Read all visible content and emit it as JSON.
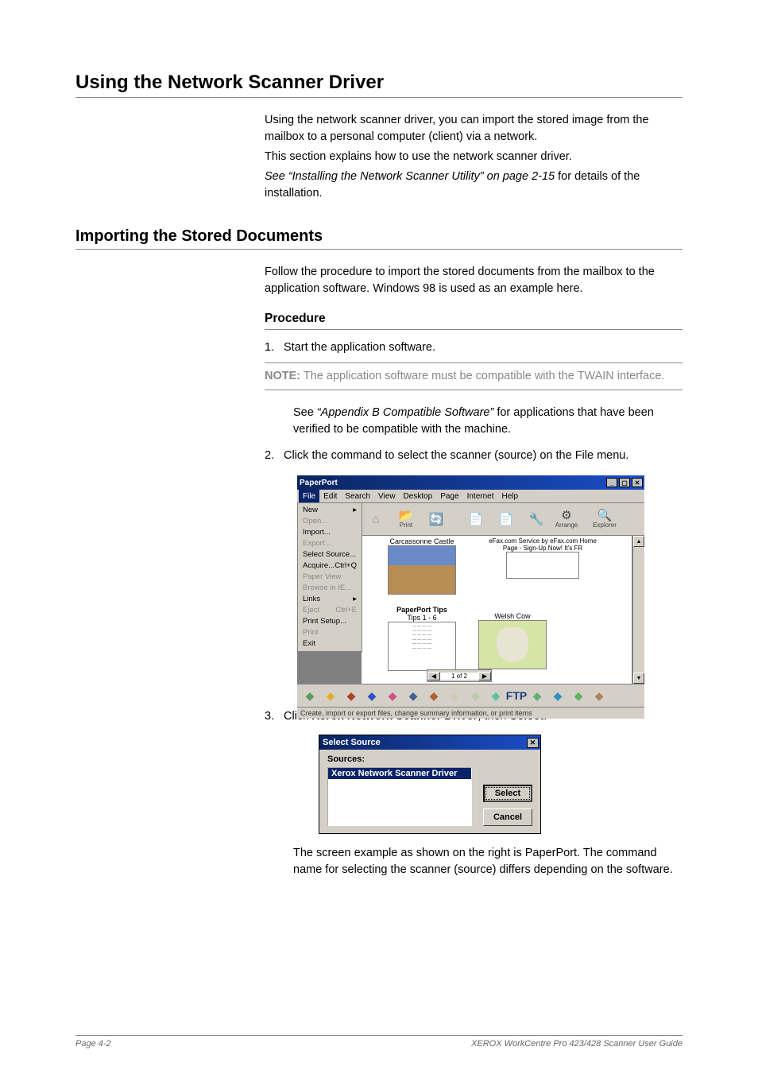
{
  "page": {
    "title": "Using the Network Scanner Driver",
    "intro": {
      "p1": "Using the network scanner driver, you can import the stored image from the mailbox to a personal computer (client) via a network.",
      "p2": "This section explains how to use the network scanner driver.",
      "p3_italic": "See “Installing the Network Scanner Utility” on page 2-15",
      "p3_rest": " for details of the installation."
    },
    "importing_heading": "Importing the Stored Documents",
    "importing_intro": "Follow the procedure to import the stored documents from the mailbox to the application software. Windows 98 is used as an example here.",
    "procedure_heading": "Procedure",
    "step1": {
      "num": "1.",
      "text": "Start the application software."
    },
    "note": {
      "label": "NOTE:",
      "text": " The application software must be compatible with the TWAIN interface."
    },
    "see_text": {
      "pre": "See ",
      "ital": "“Appendix B Compatible Software”",
      "post": " for applications that have been verified to be compatible with the machine."
    },
    "step2": {
      "num": "2.",
      "text": "Click the command to select the scanner (source) on the File menu."
    },
    "step3": {
      "num": "3.",
      "pre": "Click ",
      "b1": "Xerox Network Scanner Driver",
      "mid": ", then ",
      "b2": "Select",
      "post": "."
    },
    "closing": "The screen example as shown on the right is PaperPort. The command name for selecting the scanner (source) differs depending on the software.",
    "footer": {
      "left": "Page 4-2",
      "right": "XEROX WorkCentre Pro 423/428 Scanner User Guide"
    }
  },
  "shot1": {
    "title": "PaperPort",
    "menubar": [
      "File",
      "Edit",
      "Search",
      "View",
      "Desktop",
      "Page",
      "Internet",
      "Help"
    ],
    "toolbar": [
      {
        "glyph": "⌂",
        "label": "",
        "dim": true
      },
      {
        "glyph": "📂",
        "label": "Print",
        "dim": false
      },
      {
        "glyph": "🔄",
        "label": "",
        "dim": true
      },
      {
        "glyph": "📄",
        "label": "",
        "dim": true
      },
      {
        "glyph": "📄",
        "label": "",
        "dim": true
      },
      {
        "glyph": "🔧",
        "label": "",
        "dim": true
      },
      {
        "glyph": "⚙",
        "label": "Arrange",
        "dim": false
      },
      {
        "glyph": "🔍",
        "label": "Explorer",
        "dim": false
      }
    ],
    "file_menu": [
      {
        "label": "New",
        "shortcut": "▸",
        "dis": false
      },
      {
        "label": "Open...",
        "shortcut": "",
        "dis": true
      },
      {
        "label": "Import...",
        "shortcut": "",
        "dis": false
      },
      {
        "label": "Export...",
        "shortcut": "",
        "dis": true
      },
      {
        "label": "Select Source...",
        "shortcut": "",
        "dis": false
      },
      {
        "label": "Acquire...",
        "shortcut": "Ctrl+Q",
        "dis": false
      },
      {
        "label": "Paper View",
        "shortcut": "",
        "dis": true
      },
      {
        "label": "Browse in IE...",
        "shortcut": "",
        "dis": true
      },
      {
        "label": "Links",
        "shortcut": "▸",
        "dis": false
      },
      {
        "label": "Eject",
        "shortcut": "Ctrl+E",
        "dis": true
      },
      {
        "label": "Print Setup...",
        "shortcut": "",
        "dis": false
      },
      {
        "label": "Print",
        "shortcut": "",
        "dis": true
      },
      {
        "label": "Exit",
        "shortcut": "",
        "dis": false
      }
    ],
    "thumbs": {
      "castle": "Carcassonne Castle",
      "tips_title": "PaperPort Tips",
      "tips_sub": "Tips 1 - 6",
      "cow": "Welsh Cow",
      "efax": "eFax.com Service by eFax.com Home Page - Sign-Up Now! It's FR"
    },
    "pager": "1 of 2",
    "appbar_colors": [
      "#5a9e5a",
      "#e0b030",
      "#b04020",
      "#3050c0",
      "#d05080",
      "#406090",
      "#b06030",
      "#d0c8b0",
      "#b8c8b0",
      "#60c0a0",
      "#204080",
      "#60b070",
      "#3090c0",
      "#60b060",
      "#b08060"
    ],
    "appbar_ftp": "FTP",
    "statusbar": "Create, import or export files, change summary information, or print items"
  },
  "shot2": {
    "title": "Select Source",
    "label": "Sources:",
    "item": "Xerox Network Scanner Driver",
    "select_btn": "Select",
    "cancel_btn": "Cancel"
  }
}
